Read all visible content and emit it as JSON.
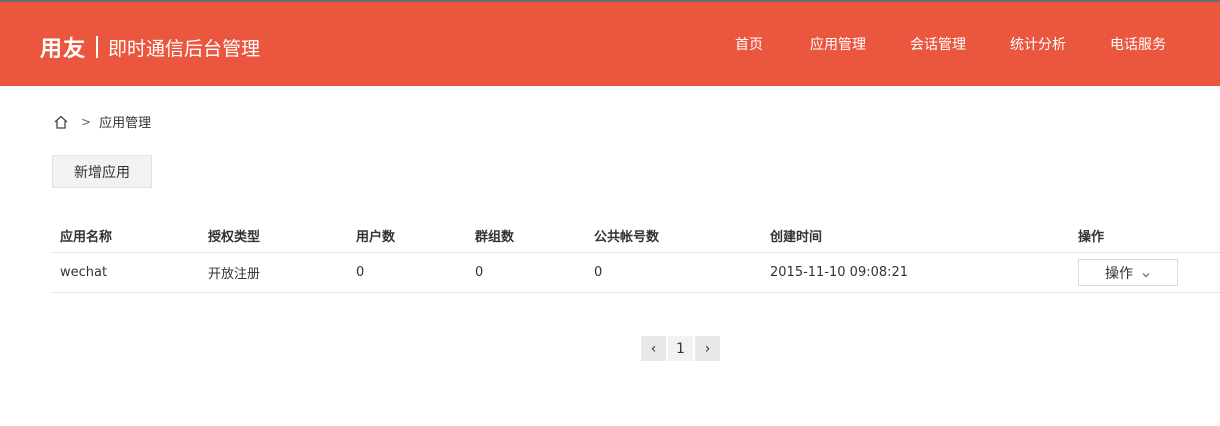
{
  "header": {
    "logo": "用友",
    "title": "即时通信后台管理",
    "nav": [
      {
        "label": "首页"
      },
      {
        "label": "应用管理"
      },
      {
        "label": "会话管理"
      },
      {
        "label": "统计分析"
      },
      {
        "label": "电话服务"
      }
    ],
    "bg_color": "#ea563e"
  },
  "breadcrumb": {
    "home_icon": "home-icon",
    "separator": ">",
    "current": "应用管理"
  },
  "toolbar": {
    "add_label": "新增应用"
  },
  "table": {
    "columns": [
      "应用名称",
      "授权类型",
      "用户数",
      "群组数",
      "公共帐号数",
      "创建时间",
      "操作"
    ],
    "rows": [
      {
        "name": "wechat",
        "auth_type": "开放注册",
        "users": "0",
        "groups": "0",
        "public_accounts": "0",
        "created": "2015-11-10 09:08:21",
        "action_label": "操作"
      }
    ]
  },
  "pagination": {
    "prev": "‹",
    "current_page": "1",
    "next": "›"
  }
}
